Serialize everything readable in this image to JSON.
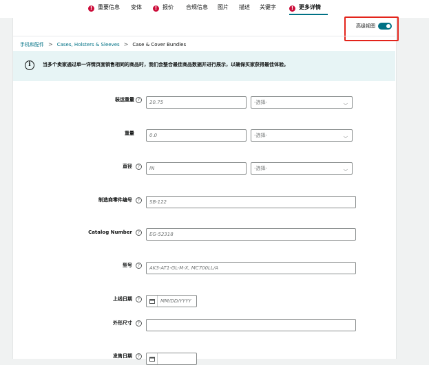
{
  "tabs": [
    {
      "label": "重要信息",
      "error": true
    },
    {
      "label": "变体",
      "error": false
    },
    {
      "label": "报价",
      "error": true
    },
    {
      "label": "合规信息",
      "error": false
    },
    {
      "label": "图片",
      "error": false
    },
    {
      "label": "描述",
      "error": false
    },
    {
      "label": "关键字",
      "error": false
    },
    {
      "label": "更多详情",
      "error": true,
      "active": true
    }
  ],
  "error_mark": "!",
  "advanced_view": {
    "label": "高级视图",
    "enabled": true
  },
  "breadcrumb": [
    "手机和配件",
    "Cases, Holsters & Sleeves",
    "Case & Cover Bundles"
  ],
  "breadcrumb_sep": ">",
  "banner": {
    "icon": "info-icon",
    "text": "当多个卖家通过单一详情页面销售相同的商品时，我们会整合最佳商品数据并进行展示，以确保买家获得最佳体验。"
  },
  "help_glyph": "?",
  "form": {
    "shipping_weight": {
      "label": "装运重量",
      "value": "20.75",
      "unit_placeholder": "-选择-"
    },
    "weight": {
      "label": "重量",
      "value": "0.0",
      "unit_placeholder": "-选择-"
    },
    "diameter": {
      "label": "直径",
      "value": "IN",
      "unit_placeholder": "-选择-"
    },
    "mfr_part_number": {
      "label": "制造商零件编号",
      "value": "SB-122"
    },
    "catalog_number": {
      "label": "Catalog Number",
      "value": "EG-52318"
    },
    "model": {
      "label": "型号",
      "value": "AK3-AT1-GL-M-X, MC700LL/A"
    },
    "launch_date": {
      "label": "上线日期",
      "placeholder": "MM/DD/YYYY"
    },
    "dimensions": {
      "label": "外形尺寸",
      "value": ""
    },
    "release_date": {
      "label": "发售日期",
      "placeholder": ""
    }
  },
  "colors": {
    "accent": "#007185",
    "error": "#cc0c39",
    "banner_bg": "#e7f4f5",
    "highlight": "#e3241b"
  }
}
